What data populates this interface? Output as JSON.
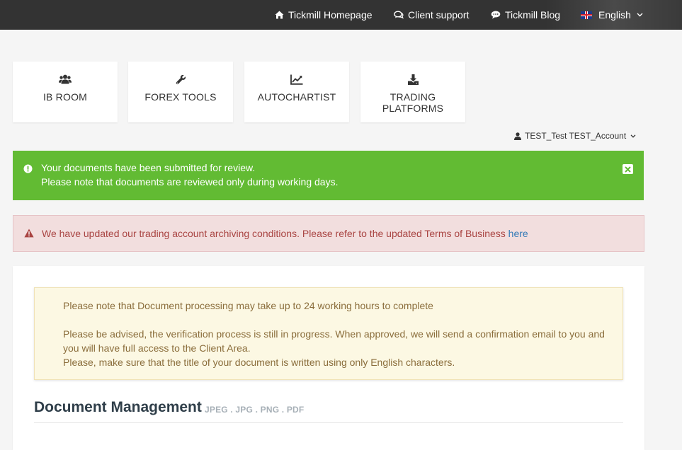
{
  "topnav": {
    "homepage_label": "Tickmill Homepage",
    "support_label": "Client support",
    "blog_label": "Tickmill Blog",
    "language_label": "English",
    "icons": {
      "homepage": "home-icon",
      "support": "chat-bubbles-icon",
      "blog": "comment-icon",
      "language": "uk-flag-icon"
    }
  },
  "tiles": [
    {
      "label": "IB ROOM",
      "icon": "users-icon"
    },
    {
      "label": "FOREX TOOLS",
      "icon": "wrench-icon"
    },
    {
      "label": "AUTOCHARTIST",
      "icon": "line-chart-icon"
    },
    {
      "label": "TRADING PLATFORMS",
      "label_line1": "TRADING",
      "label_line2": "PLATFORMS",
      "icon": "download-icon"
    }
  ],
  "user": {
    "name": "TEST_Test TEST_Account",
    "icon": "user-icon"
  },
  "alerts": {
    "success": {
      "line1": "Your documents have been submitted for review.",
      "line2": "Please note that documents are reviewed only during working days.",
      "color": "#62bb33"
    },
    "danger": {
      "text": "We have updated our trading account archiving conditions. Please refer to the updated Terms of Business ",
      "link_text": "here",
      "color": "#f2dede"
    }
  },
  "notice": {
    "line1": "Please note that Document processing may take up to 24 working hours to complete",
    "line2": "Please be advised, the verification process is still in progress. When approved, we will send a confirmation email to you and",
    "line3": "you will have full access to the Client Area.",
    "line4": "Please, make sure that the title of your document is written using only English characters."
  },
  "document_management": {
    "title": "Document Management",
    "formats": "JPEG . JPG . PNG . PDF"
  }
}
